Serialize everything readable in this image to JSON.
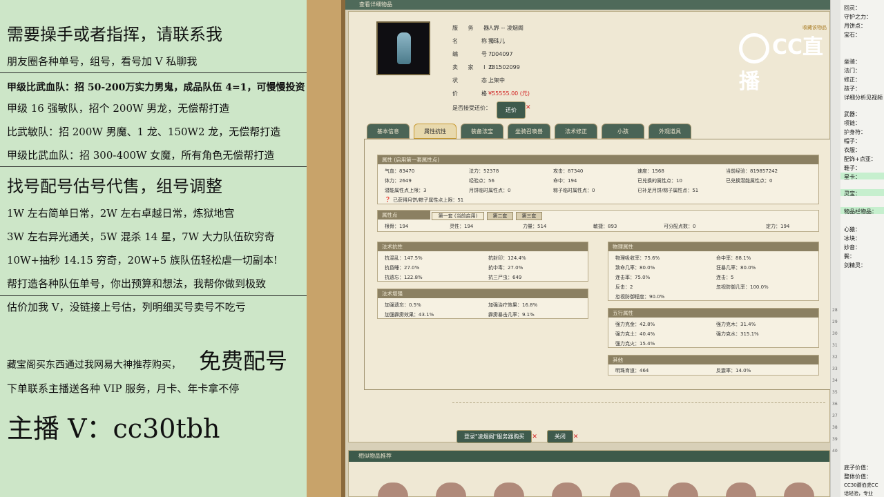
{
  "left_overlay": {
    "lines": [
      "需要操手或者指挥，请联系我",
      "朋友圈各种单号，组号，看号加 V 私聊我",
      "甲级比武血队：招 50-200万实力男鬼，成品队伍 4=1，可慢慢投资",
      "甲级 16 强敏队，招个 200W 男龙，无偿帮打造",
      "比武敏队：招 200W 男魔、1 龙、150W2 龙，无偿帮打造",
      "甲级比武血队：招 300-400W 女魔，所有角色无偿帮打造",
      "找号配号估号代售，组号调整",
      "1W 左右简单日常，2W 左右卓越日常，炼狱地宫",
      "3W 左右异光通关，5W 混杀 14 星，7W 大力队伍砍穷奇",
      "10W+抽秒 14.15 穷奇，20W+5 族队伍轻松虐一切副本!",
      "帮打造各种队伍单号，你出预算和想法，我帮你做到极致",
      "估价加我 V，没链接上号估，列明细买号卖号不吃亏"
    ],
    "line_14": "藏宝阁买东西通过我网易大神推荐购买，",
    "free": "免费配号",
    "line_15": "下单联系主播送各种 VIP 服务，月卡、年卡拿不停",
    "anchor": "主播 V：cc30tbh"
  },
  "window": {
    "title": "查看详细物品",
    "favorite": "收藏该物品"
  },
  "item": {
    "server_label": "服 务 器：",
    "server": "人界 -- 凌烟阁",
    "name_label": "名　　称：",
    "name": "獨珠儿",
    "id_label": "编　　号：",
    "id": "7004097",
    "seller_label": "卖 家 ID：",
    "seller": "231502099",
    "status_label": "状　　态：",
    "status": "上架中",
    "price_label": "价　　格：",
    "price": "¥55555.00 (元)",
    "bargain_label": "是否接受还价：",
    "bargain_button": "还价"
  },
  "tabs": [
    "基本信息",
    "属性抗性",
    "装备法宝",
    "坐骑召唤兽",
    "法术修正",
    "小孩",
    "外观道具"
  ],
  "attr": {
    "header": "属性 (启用第一套属性点)",
    "rows": [
      [
        "气血：83470",
        "法力：52378",
        "攻击：87340",
        "速度：1568",
        "当前经验：819857242"
      ],
      [
        "体力：2649",
        "经验点：56",
        "命中：194",
        "已兑换的属性点：10",
        "已兑换潜能属性点：0"
      ],
      [
        "潜能属性点上限：3",
        "月饼临时属性点：0",
        "粽子临时属性点：0",
        "已补足月饼/粽子属性点：51",
        ""
      ]
    ],
    "note": "已获得月饼/粽子属性点上限：51"
  },
  "points": {
    "header": "属性点",
    "tabs": [
      "第一套 (当前启用)",
      "第二套",
      "第三套"
    ],
    "values": [
      "根骨：194",
      "灵性：194",
      "力量：514",
      "敏捷：893",
      "可分配点数：0",
      "定力：194"
    ]
  },
  "resist": {
    "header": "法术抗性",
    "values": [
      "抗混乱：147.5%",
      "抗封印：124.4%",
      "抗昏睡：27.0%",
      "抗中毒：27.0%",
      "抗遗忘：122.8%",
      "抗三尸虫：649"
    ]
  },
  "boost": {
    "header": "法术增强",
    "values": [
      "加强遗忘：0.5%",
      "加强治疗效果：16.8%",
      "加强霹雳效果：43.1%",
      "霹雳暴击几率：9.1%"
    ]
  },
  "physical": {
    "header": "物理属性",
    "values": [
      "物理吸收率：75.6%",
      "命中率：88.1%",
      "致命几率：80.0%",
      "狂暴几率：80.0%",
      "连击率：75.0%",
      "连击：5",
      "反击：2",
      "忽视防御几率：100.0%",
      "忽视防御程度：90.0%"
    ]
  },
  "wuxing": {
    "header": "五行属性",
    "values": [
      "强力克金：42.8%",
      "强力克木：31.4%",
      "强力克土：40.4%",
      "强力克水：315.1%",
      "强力克火：15.4%"
    ]
  },
  "other": {
    "header": "其他",
    "values": [
      "明珠育道：464",
      "反震率：14.0%"
    ]
  },
  "buttons": {
    "login": "登录\"凌烟阁\"服务器购买",
    "close": "关闭"
  },
  "similar": {
    "header": "相似物品推荐"
  },
  "logo": {
    "text": "CC直播"
  },
  "sidebar": {
    "labels": [
      "回灵：",
      "守护之力：",
      "月饼点：",
      "宝石：",
      "",
      "",
      "坐骑：",
      "法门：",
      "修正：",
      "孩子：",
      "详细分析见视频",
      "武器：",
      "项链：",
      "护身符：",
      "帽子：",
      "衣服：",
      "配饰+点亚：",
      "鞋子：",
      "星卡：",
      "灵宝：",
      "物品栏物品：",
      "心猿：",
      "冰块：",
      "妙音：",
      "鬓：",
      "剑精灵："
    ],
    "bottom": [
      "底子价值：",
      "整体价值：",
      "CC30蘑伯虎CC",
      "话轻验，专业"
    ],
    "row_numbers": [
      "28",
      "29",
      "30",
      "31",
      "32",
      "33",
      "34",
      "35",
      "36",
      "37",
      "38",
      "39",
      "40"
    ]
  }
}
